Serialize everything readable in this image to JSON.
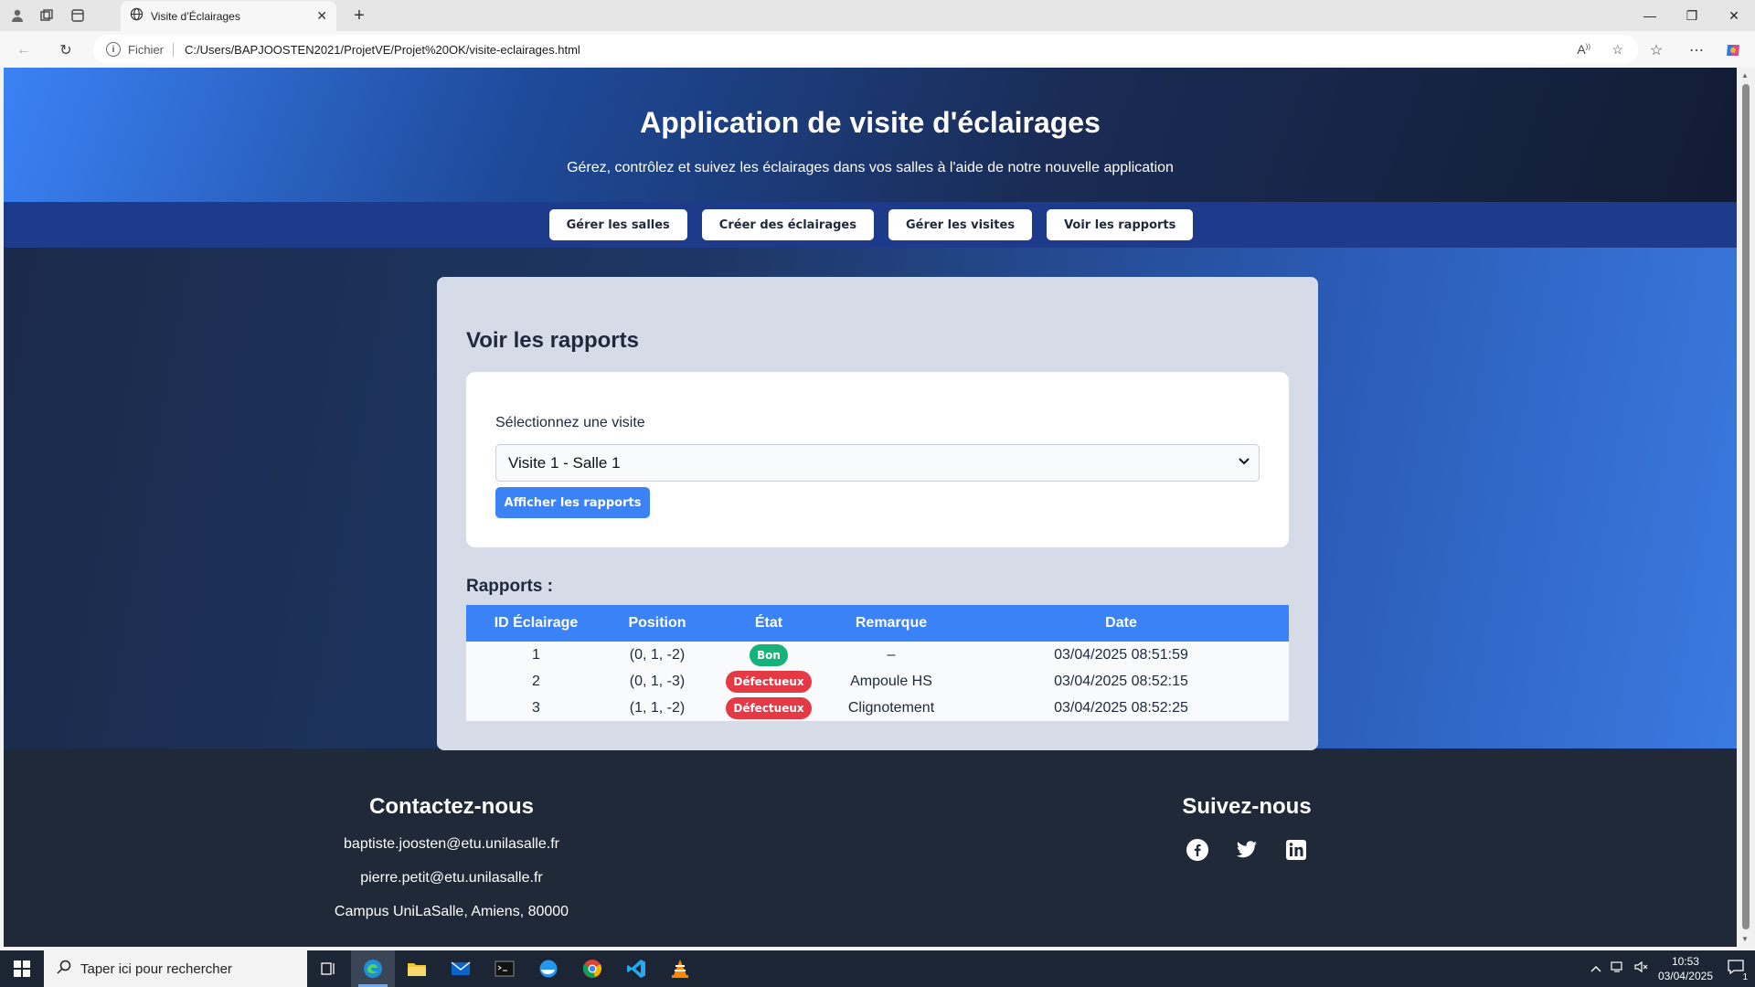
{
  "browser": {
    "tab_title": "Visite d’Éclairages",
    "scheme": "Fichier",
    "url": "C:/Users/BAPJOOSTEN2021/ProjetVE/Projet%20OK/visite-eclairages.html"
  },
  "header": {
    "title": "Application de visite d'éclairages",
    "subtitle": "Gérez, contrôlez et suivez les éclairages dans vos salles à l'aide de notre nouvelle application"
  },
  "nav": {
    "items": [
      {
        "label": "Gérer les salles"
      },
      {
        "label": "Créer des éclairages"
      },
      {
        "label": "Gérer les visites"
      },
      {
        "label": "Voir les rapports"
      }
    ]
  },
  "reports_page": {
    "title": "Voir les rapports",
    "select_label": "Sélectionnez une visite",
    "select_value": "Visite 1 - Salle 1",
    "show_button": "Afficher les rapports",
    "reports_heading": "Rapports :",
    "columns": [
      "ID Éclairage",
      "Position",
      "État",
      "Remarque",
      "Date"
    ],
    "rows": [
      {
        "id": "1",
        "position": "(0, 1, -2)",
        "state": "Bon",
        "state_color": "#16b27a",
        "remark": "–",
        "date": "03/04/2025 08:51:59"
      },
      {
        "id": "2",
        "position": "(0, 1, -3)",
        "state": "Défectueux",
        "state_color": "#e53945",
        "remark": "Ampoule HS",
        "date": "03/04/2025 08:52:15"
      },
      {
        "id": "3",
        "position": "(1, 1, -2)",
        "state": "Défectueux",
        "state_color": "#e53945",
        "remark": "Clignotement",
        "date": "03/04/2025 08:52:25"
      }
    ]
  },
  "footer": {
    "contact_title": "Contactez-nous",
    "email_1": "baptiste.joosten@etu.unilasalle.fr",
    "email_2": "pierre.petit@etu.unilasalle.fr",
    "address": "Campus UniLaSalle, Amiens, 80000",
    "social_title": "Suivez-nous",
    "social_icons": [
      "facebook-icon",
      "twitter-icon",
      "linkedin-icon"
    ]
  },
  "taskbar": {
    "search_placeholder": "Taper ici pour rechercher",
    "time": "10:53",
    "date": "03/04/2025",
    "notification_count": "1"
  },
  "colors": {
    "accent": "#3b82f6",
    "nav_bar": "#1e3a8a",
    "footer": "#1f2937",
    "good": "#16b27a",
    "bad": "#e53945"
  }
}
